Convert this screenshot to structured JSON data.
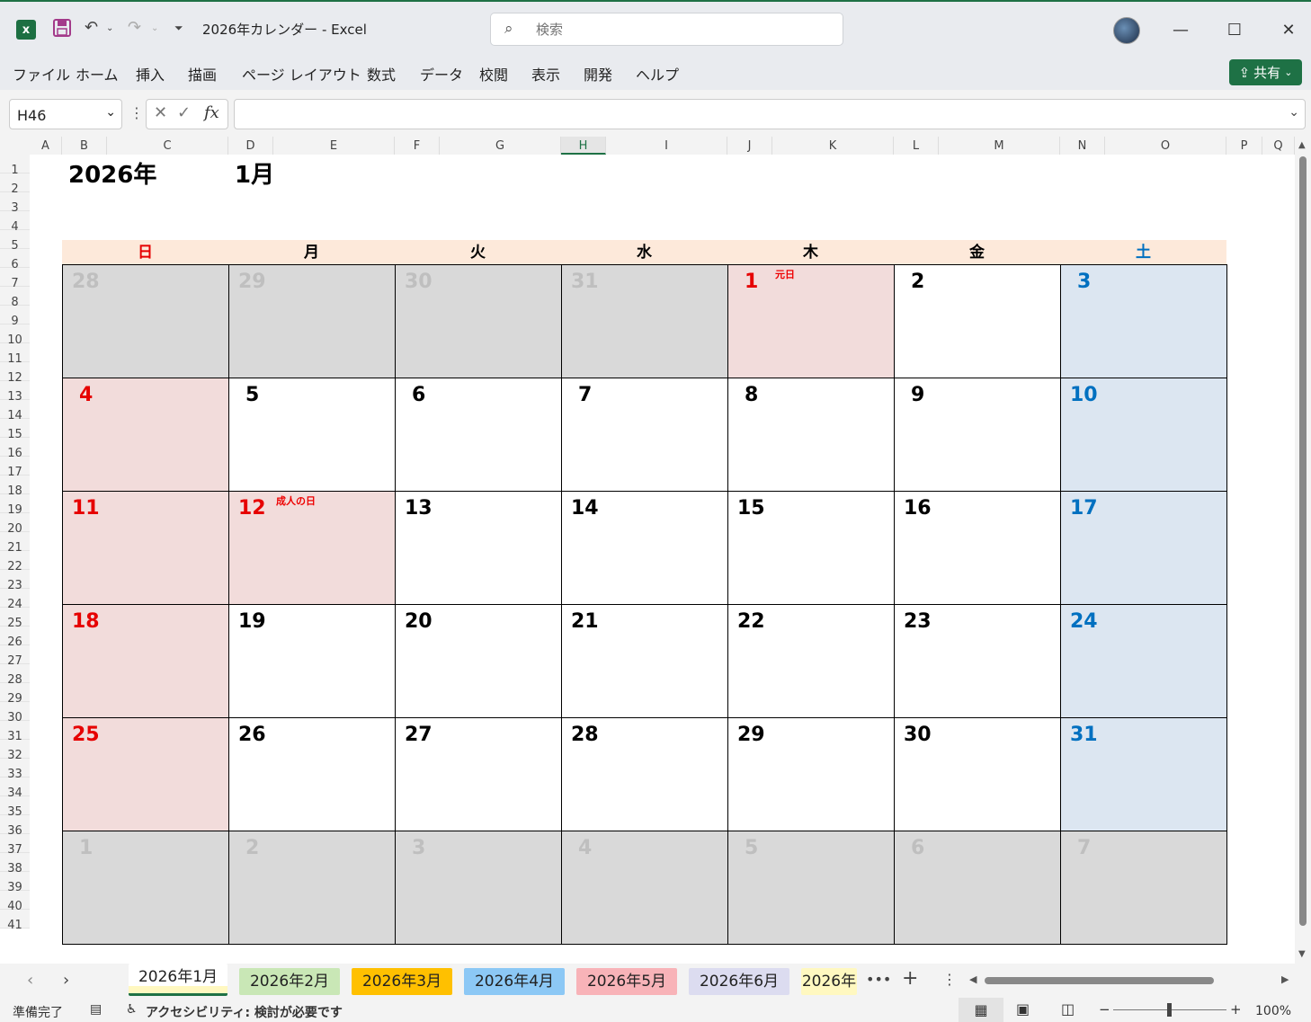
{
  "window": {
    "title": "2026年カレンダー  -  Excel",
    "search_placeholder": "検索",
    "share_label": "共有"
  },
  "ribbon_tabs": [
    "ファイル",
    "ホーム",
    "挿入",
    "描画",
    "ページ レイアウト",
    "数式",
    "データ",
    "校閲",
    "表示",
    "開発",
    "ヘルプ"
  ],
  "formula_bar": {
    "name_box": "H46",
    "formula": ""
  },
  "columns": [
    "A",
    "B",
    "C",
    "D",
    "E",
    "F",
    "G",
    "H",
    "I",
    "J",
    "K",
    "L",
    "M",
    "N",
    "O",
    "P",
    "Q"
  ],
  "selected_column": "H",
  "rows": [
    "1",
    "2",
    "3",
    "4",
    "5",
    "6",
    "7",
    "8",
    "9",
    "10",
    "11",
    "12",
    "13",
    "14",
    "15",
    "16",
    "17",
    "18",
    "19",
    "20",
    "21",
    "22",
    "23",
    "24",
    "25",
    "26",
    "27",
    "28",
    "29",
    "30",
    "31",
    "32",
    "33",
    "34",
    "35",
    "36",
    "37",
    "38",
    "39",
    "40",
    "41"
  ],
  "calendar": {
    "year": "2026年",
    "month": "1月",
    "weekdays": [
      "日",
      "月",
      "火",
      "水",
      "木",
      "金",
      "土"
    ],
    "weeks": [
      [
        {
          "d": "28",
          "t": "other"
        },
        {
          "d": "29",
          "t": "other"
        },
        {
          "d": "30",
          "t": "other"
        },
        {
          "d": "31",
          "t": "other"
        },
        {
          "d": "1",
          "t": "holiday",
          "note": "元日"
        },
        {
          "d": "2",
          "t": "normal"
        },
        {
          "d": "3",
          "t": "sat"
        }
      ],
      [
        {
          "d": "4",
          "t": "sun"
        },
        {
          "d": "5",
          "t": "normal"
        },
        {
          "d": "6",
          "t": "normal"
        },
        {
          "d": "7",
          "t": "normal"
        },
        {
          "d": "8",
          "t": "normal"
        },
        {
          "d": "9",
          "t": "normal"
        },
        {
          "d": "10",
          "t": "sat"
        }
      ],
      [
        {
          "d": "11",
          "t": "sun"
        },
        {
          "d": "12",
          "t": "holiday",
          "note": "成人の日"
        },
        {
          "d": "13",
          "t": "normal"
        },
        {
          "d": "14",
          "t": "normal"
        },
        {
          "d": "15",
          "t": "normal"
        },
        {
          "d": "16",
          "t": "normal"
        },
        {
          "d": "17",
          "t": "sat"
        }
      ],
      [
        {
          "d": "18",
          "t": "sun"
        },
        {
          "d": "19",
          "t": "normal"
        },
        {
          "d": "20",
          "t": "normal"
        },
        {
          "d": "21",
          "t": "normal"
        },
        {
          "d": "22",
          "t": "normal"
        },
        {
          "d": "23",
          "t": "normal"
        },
        {
          "d": "24",
          "t": "sat"
        }
      ],
      [
        {
          "d": "25",
          "t": "sun"
        },
        {
          "d": "26",
          "t": "normal"
        },
        {
          "d": "27",
          "t": "normal"
        },
        {
          "d": "28",
          "t": "normal"
        },
        {
          "d": "29",
          "t": "normal"
        },
        {
          "d": "30",
          "t": "normal"
        },
        {
          "d": "31",
          "t": "sat"
        }
      ],
      [
        {
          "d": "1",
          "t": "other"
        },
        {
          "d": "2",
          "t": "other"
        },
        {
          "d": "3",
          "t": "other"
        },
        {
          "d": "4",
          "t": "other"
        },
        {
          "d": "5",
          "t": "other"
        },
        {
          "d": "6",
          "t": "other"
        },
        {
          "d": "7",
          "t": "other"
        }
      ]
    ]
  },
  "sheet_tabs": [
    {
      "label": "2026年1月",
      "color": "#fff8c0",
      "active": true
    },
    {
      "label": "2026年2月",
      "color": "#c9e7b6",
      "active": false
    },
    {
      "label": "2026年3月",
      "color": "#ffc000",
      "active": false
    },
    {
      "label": "2026年4月",
      "color": "#8cc8f5",
      "active": false
    },
    {
      "label": "2026年5月",
      "color": "#f8b3b8",
      "active": false
    },
    {
      "label": "2026年6月",
      "color": "#dcdcf0",
      "active": false
    },
    {
      "label": "2026年",
      "color": "#fff8c0",
      "active": false
    }
  ],
  "status": {
    "ready": "準備完了",
    "accessibility": "アクセシビリティ: 検討が必要です",
    "zoom": "100%"
  },
  "colors": {
    "sunday": "#e60000",
    "saturday": "#0070c0",
    "other_text": "#bfbfbf",
    "other_bg": "#d9d9d9",
    "holiday_bg": "#f2dcdb",
    "saturday_bg": "#dce6f1",
    "accent": "#1e7145"
  }
}
